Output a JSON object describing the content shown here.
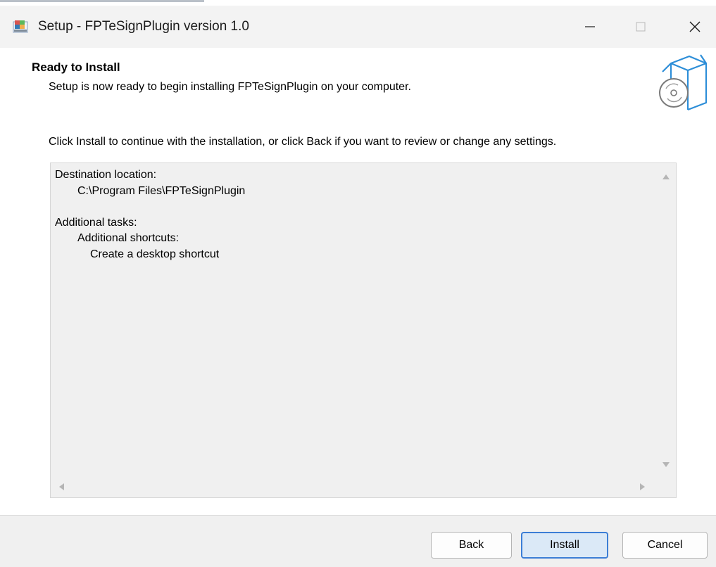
{
  "window": {
    "title": "Setup - FPTeSignPlugin version 1.0"
  },
  "header": {
    "title": "Ready to Install",
    "subtitle": "Setup is now ready to begin installing FPTeSignPlugin on your computer."
  },
  "instructions": "Click Install to continue with the installation, or click Back if you want to review or change any settings.",
  "memo": {
    "lines": [
      "Destination location:",
      "C:\\Program Files\\FPTeSignPlugin",
      "",
      "Additional tasks:",
      "Additional shortcuts:",
      "Create a desktop shortcut"
    ]
  },
  "buttons": {
    "back": "Back",
    "install": "Install",
    "cancel": "Cancel"
  },
  "colors": {
    "accent": "#3c7ed6",
    "titlebar": "#f3f3f3",
    "memo_bg": "#f0f0f0"
  },
  "icons": {
    "app": "setup-app-icon",
    "header": "software-box-cd-icon"
  }
}
